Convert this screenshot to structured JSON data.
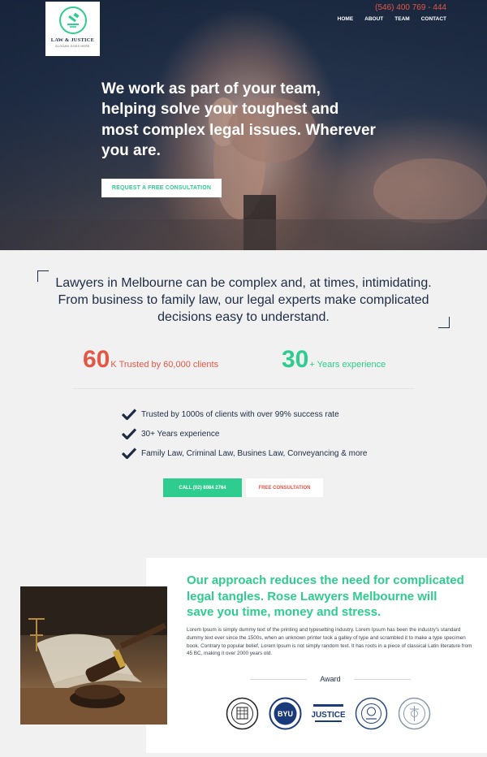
{
  "header": {
    "logo": {
      "title": "LAW & JUSTICE",
      "slogan": "SLOGAN GOES HERE",
      "icon": "scales-gavel-icon"
    },
    "phone": "(546) 400 769 - 444",
    "nav": [
      "HOME",
      "ABOUT",
      "TEAM",
      "CONTACT"
    ]
  },
  "hero": {
    "heading": "We work as part of your team, helping solve your toughest and most complex legal issues. Wherever you are.",
    "cta": "REQUEST A FREE CONSULTATION"
  },
  "intro": {
    "text": "Lawyers in Melbourne can be complex and, at times, intimidating. From business to family law, our legal experts make complicated decisions easy to understand."
  },
  "stats": [
    {
      "number": "60",
      "label": "K Trusted by 60,000 clients",
      "color": "#e55745"
    },
    {
      "number": "30",
      "label": "+ Years experience",
      "color": "#2ecc8e"
    }
  ],
  "checks": [
    "Trusted by 1000s of clients with over 99% success rate",
    "30+ Years experience",
    "Family Law, Criminal Law, Busines Law, Conveyancing & more"
  ],
  "buttons": {
    "call": "CALL (02) 8084 2764",
    "free": "FREE CONSULTATION"
  },
  "approach": {
    "heading": "Our approach reduces the need for complicated legal tangles. Rose Lawyers Melbourne will save you time, money and stress.",
    "body": "Lorem Ipsum is simply dummy text of the printing and typesetting industry. Lorem Ipsum has been the industry's standard dummy text ever since the 1500s, when an unknown printer took a galley of type and scrambled it to make a type specimen book. Contrary to popular belief, Lorem Ipsum is not simply random text. It has roots in a piece of classical Latin literature from 45 BC, making it over 2000 years old.",
    "award_title": "Award",
    "badges": [
      {
        "icon": "law-school-seal-icon"
      },
      {
        "icon": "byu-seal-icon",
        "text": "BYU"
      },
      {
        "icon": "justice-association-logo-icon",
        "text": "JUSTICE"
      },
      {
        "icon": "court-seal-icon"
      },
      {
        "icon": "state-seal-icon"
      }
    ]
  },
  "colors": {
    "accent_green": "#2ecc8e",
    "accent_red": "#e55745",
    "navy": "#1d2c44",
    "background": "#f1f1f2"
  }
}
